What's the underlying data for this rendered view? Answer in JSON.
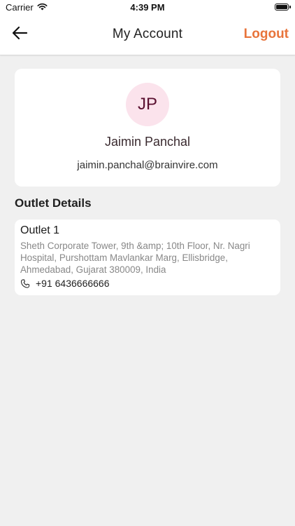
{
  "status_bar": {
    "carrier": "Carrier",
    "time": "4:39 PM"
  },
  "nav": {
    "title": "My Account",
    "logout_label": "Logout"
  },
  "profile": {
    "initials": "JP",
    "name": "Jaimin Panchal",
    "email": "jaimin.panchal@brainvire.com"
  },
  "outlets": {
    "heading": "Outlet Details",
    "items": [
      {
        "name": "Outlet 1",
        "address": "Sheth Corporate Tower, 9th &amp; 10th Floor, Nr. Nagri Hospital, Purshottam Mavlankar Marg, Ellisbridge, Ahmedabad, Gujarat 380009, India",
        "phone": "+91 6436666666"
      }
    ]
  },
  "colors": {
    "accent": "#e8743b",
    "avatar_bg": "#fbe3ec",
    "background": "#f0f0f0"
  },
  "icons": {
    "back": "arrow-left-icon",
    "wifi": "wifi-icon",
    "battery": "battery-icon",
    "phone": "phone-icon"
  }
}
